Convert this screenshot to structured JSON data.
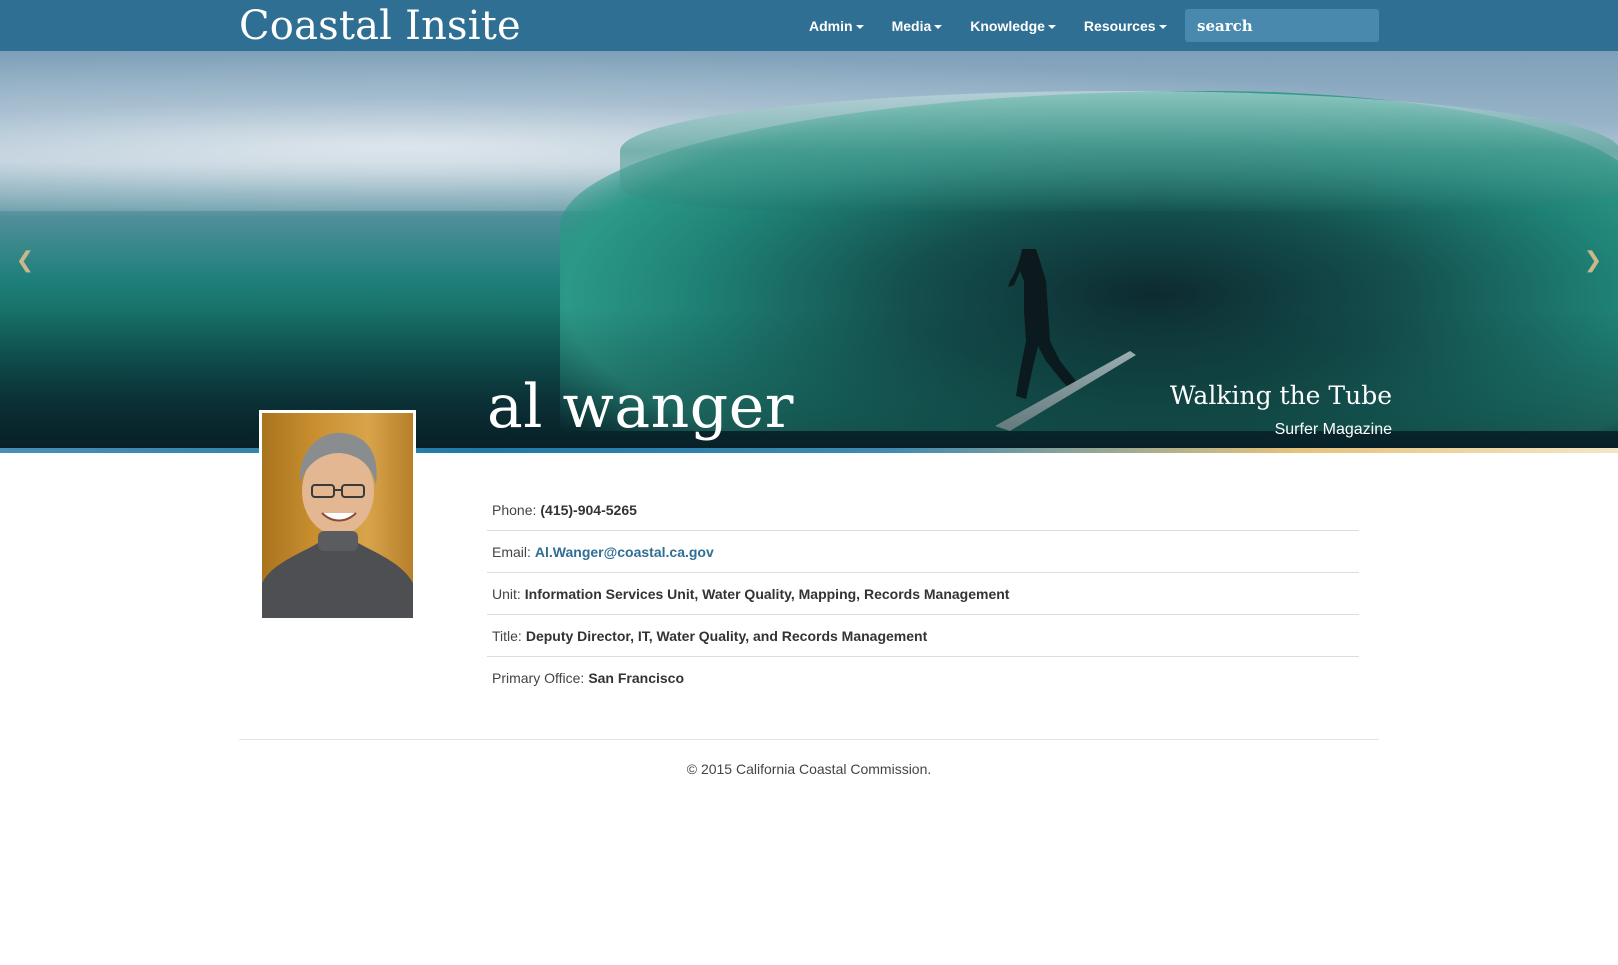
{
  "navbar": {
    "brand": "Coastal Insite",
    "menu": [
      {
        "label": "Admin"
      },
      {
        "label": "Media"
      },
      {
        "label": "Knowledge"
      },
      {
        "label": "Resources"
      }
    ],
    "search_placeholder": "search",
    "background_color": "#2f6f93"
  },
  "hero": {
    "person_name": "al wanger",
    "caption_title": "Walking the Tube",
    "caption_source": "Surfer Magazine",
    "prev_arrow": "chevron-left-icon",
    "next_arrow": "chevron-right-icon"
  },
  "profile": {
    "photo": "profile-photo",
    "fields": [
      {
        "label": "Phone:",
        "value": "(415)-904-5265"
      },
      {
        "label": "Email:",
        "value": "Al.Wanger@coastal.ca.gov"
      },
      {
        "label": "Unit:",
        "value": "Information Services Unit, Water Quality, Mapping, Records Management"
      },
      {
        "label": "Title:",
        "value": "Deputy Director, IT, Water Quality, and Records Management"
      },
      {
        "label": "Primary Office:",
        "value": "San Francisco"
      }
    ],
    "link_color": "#2f6f93"
  },
  "footer": {
    "copyright": "© 2015 California Coastal Commission."
  }
}
